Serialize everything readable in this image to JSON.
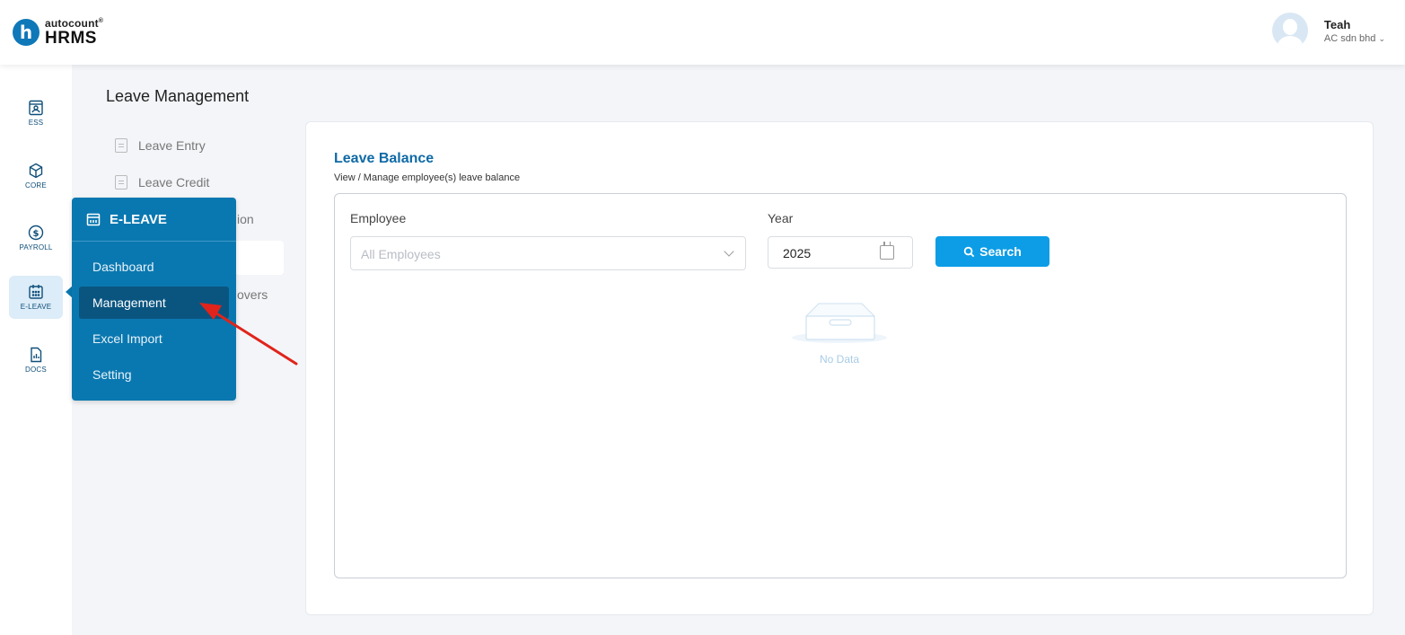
{
  "brand": {
    "top": "autocount",
    "reg": "®",
    "bottom": "HRMS",
    "mark": "h"
  },
  "user": {
    "name": "Teah",
    "company": "AC sdn bhd"
  },
  "rail": [
    {
      "label": "ESS",
      "icon": "ess-icon"
    },
    {
      "label": "CORE",
      "icon": "core-icon"
    },
    {
      "label": "PAYROLL",
      "icon": "payroll-icon"
    },
    {
      "label": "E-LEAVE",
      "icon": "calendar-icon"
    },
    {
      "label": "DOCS",
      "icon": "docs-icon"
    }
  ],
  "section": {
    "title": "Leave Management",
    "items": [
      "Leave Entry",
      "Leave Credit"
    ],
    "peek": [
      "ion",
      "overs"
    ]
  },
  "flyout": {
    "title": "E-LEAVE",
    "items": [
      "Dashboard",
      "Management",
      "Excel Import",
      "Setting"
    ],
    "active": "Management"
  },
  "card": {
    "title": "Leave Balance",
    "subtitle": "View / Manage employee(s) leave balance",
    "employee_label": "Employee",
    "employee_placeholder": "All Employees",
    "year_label": "Year",
    "year_value": "2025",
    "search_label": "Search",
    "empty_text": "No Data"
  },
  "colors": {
    "brand_blue": "#0a78b0",
    "button_blue": "#0c9de6",
    "title_blue": "#0f6aa6",
    "annotation_red": "#e0241b"
  }
}
